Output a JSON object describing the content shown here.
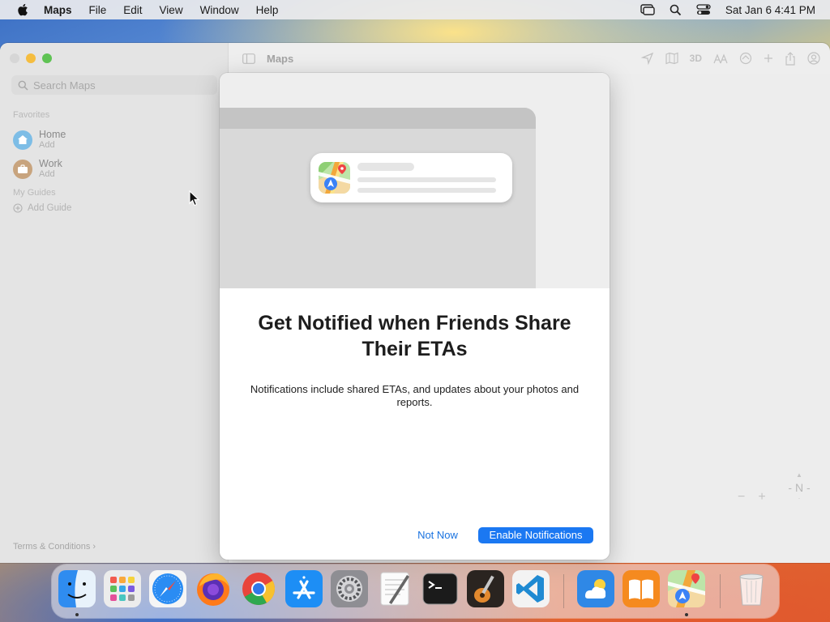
{
  "menubar": {
    "app": "Maps",
    "items": [
      "File",
      "Edit",
      "View",
      "Window",
      "Help"
    ],
    "clock": "Sat Jan 6  4:41 PM"
  },
  "sidebar": {
    "search_placeholder": "Search Maps",
    "favorites_header": "Favorites",
    "favorites": [
      {
        "label": "Home",
        "sub": "Add",
        "icon": "house-icon",
        "color": "#5aaee0"
      },
      {
        "label": "Work",
        "sub": "Add",
        "icon": "briefcase-icon",
        "color": "#b58a5a"
      }
    ],
    "guides_header": "My Guides",
    "add_guide": "Add Guide",
    "terms": "Terms & Conditions"
  },
  "toolbar": {
    "title": "Maps",
    "three_d": "3D"
  },
  "modal": {
    "title": "Get Notified when Friends Share Their ETAs",
    "body": "Notifications include shared ETAs, and updates about your photos and reports.",
    "not_now": "Not Now",
    "enable": "Enable Notifications"
  },
  "map_controls": {
    "zoom_out": "−",
    "zoom_in": "+",
    "compass": "N"
  },
  "dock": {
    "apps": [
      {
        "name": "finder-icon",
        "running": true
      },
      {
        "name": "launchpad-icon",
        "running": false
      },
      {
        "name": "safari-icon",
        "running": false
      },
      {
        "name": "firefox-icon",
        "running": false
      },
      {
        "name": "chrome-icon",
        "running": false
      },
      {
        "name": "app-store-icon",
        "running": false
      },
      {
        "name": "system-settings-icon",
        "running": false
      },
      {
        "name": "textedit-icon",
        "running": false
      },
      {
        "name": "terminal-icon",
        "running": false
      },
      {
        "name": "garageband-icon",
        "running": false
      },
      {
        "name": "vscode-icon",
        "running": false
      },
      {
        "name": "weather-icon",
        "running": false
      },
      {
        "name": "books-icon",
        "running": false
      },
      {
        "name": "maps-icon",
        "running": true
      },
      {
        "name": "trash-icon",
        "running": false
      }
    ]
  },
  "colors": {
    "accent": "#1b78f2",
    "link": "#1a73e0"
  }
}
